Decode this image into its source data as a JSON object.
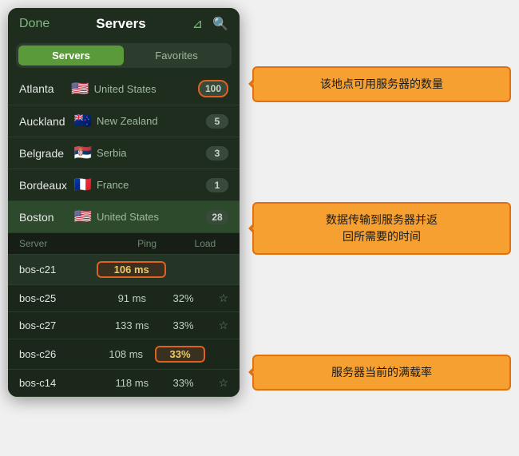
{
  "header": {
    "done_label": "Done",
    "title": "Servers",
    "filter_icon": "filter-icon",
    "search_icon": "search-icon"
  },
  "tabs": [
    {
      "label": "Servers",
      "active": true
    },
    {
      "label": "Favorites",
      "active": false
    }
  ],
  "server_list": [
    {
      "city": "Atlanta",
      "flag": "🇺🇸",
      "country": "United States",
      "count": "100",
      "highlighted": false,
      "count_highlighted": true
    },
    {
      "city": "Auckland",
      "flag": "🇳🇿",
      "country": "New Zealand",
      "count": "5",
      "highlighted": false,
      "count_highlighted": false
    },
    {
      "city": "Belgrade",
      "flag": "🇷🇸",
      "country": "Serbia",
      "count": "3",
      "highlighted": false,
      "count_highlighted": false
    },
    {
      "city": "Bordeaux",
      "flag": "🇫🇷",
      "country": "France",
      "count": "1",
      "highlighted": false,
      "count_highlighted": false
    },
    {
      "city": "Boston",
      "flag": "🇺🇸",
      "country": "United States",
      "count": "28",
      "highlighted": true,
      "count_highlighted": false
    }
  ],
  "sub_header": {
    "col1": "Server",
    "col2": "Ping",
    "col3": "Load"
  },
  "sub_servers": [
    {
      "name": "bos-c21",
      "ping": "106 ms",
      "load": "",
      "star": false,
      "ping_highlighted": true,
      "load_highlighted": false,
      "selected": true
    },
    {
      "name": "bos-c25",
      "ping": "91 ms",
      "load": "32%",
      "star": true,
      "ping_highlighted": false,
      "load_highlighted": false,
      "selected": false
    },
    {
      "name": "bos-c27",
      "ping": "133 ms",
      "load": "33%",
      "star": true,
      "ping_highlighted": false,
      "load_highlighted": false,
      "selected": false
    },
    {
      "name": "bos-c26",
      "ping": "108 ms",
      "load": "33%",
      "star": false,
      "ping_highlighted": false,
      "load_highlighted": true,
      "selected": false
    },
    {
      "name": "bos-c14",
      "ping": "118 ms",
      "load": "33%",
      "star": true,
      "ping_highlighted": false,
      "load_highlighted": false,
      "selected": false
    }
  ],
  "annotations": [
    {
      "text": "该地点可用服务器的数量"
    },
    {
      "text": "数据传输到服务器并返\n回所需要的时间"
    },
    {
      "text": "服务器当前的满载率"
    }
  ]
}
